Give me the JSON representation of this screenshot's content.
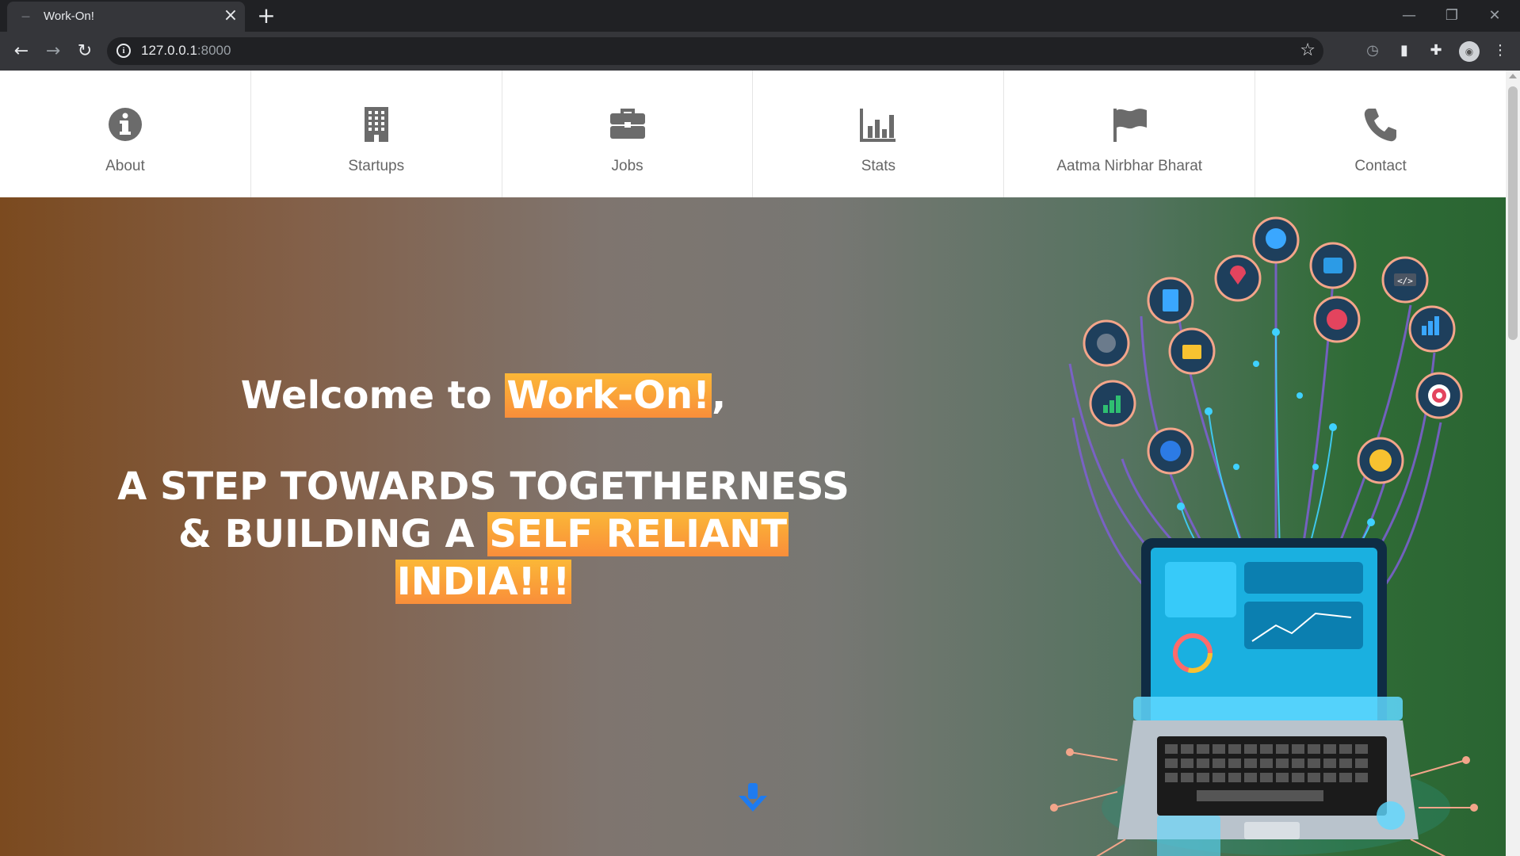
{
  "browser": {
    "tab_title": "Work-On!",
    "url_host": "127.0.0.1",
    "url_port": ":8000"
  },
  "nav": {
    "items": [
      {
        "label": "About",
        "icon": "info-circle-icon"
      },
      {
        "label": "Startups",
        "icon": "building-icon"
      },
      {
        "label": "Jobs",
        "icon": "briefcase-icon"
      },
      {
        "label": "Stats",
        "icon": "bar-chart-icon"
      },
      {
        "label": "Aatma Nirbhar Bharat",
        "icon": "flag-icon"
      },
      {
        "label": "Contact",
        "icon": "phone-icon"
      }
    ]
  },
  "hero": {
    "welcome_prefix": "Welcome to ",
    "welcome_highlight": "Work-On!",
    "welcome_suffix": ",",
    "tagline_line1": "A STEP TOWARDS TOGETHERNESS",
    "tagline_line2_prefix": "& BUILDING A ",
    "tagline_highlight_a": "SELF RELIANT",
    "tagline_highlight_b": "INDIA!!!",
    "illustration": "technology-tree-laptop-illustration",
    "scroll_icon": "arrow-down-icon"
  },
  "colors": {
    "highlight": "#f9a33a",
    "scroll_arrow": "#1e7bf0",
    "nav_icon": "#6b6b6b"
  }
}
